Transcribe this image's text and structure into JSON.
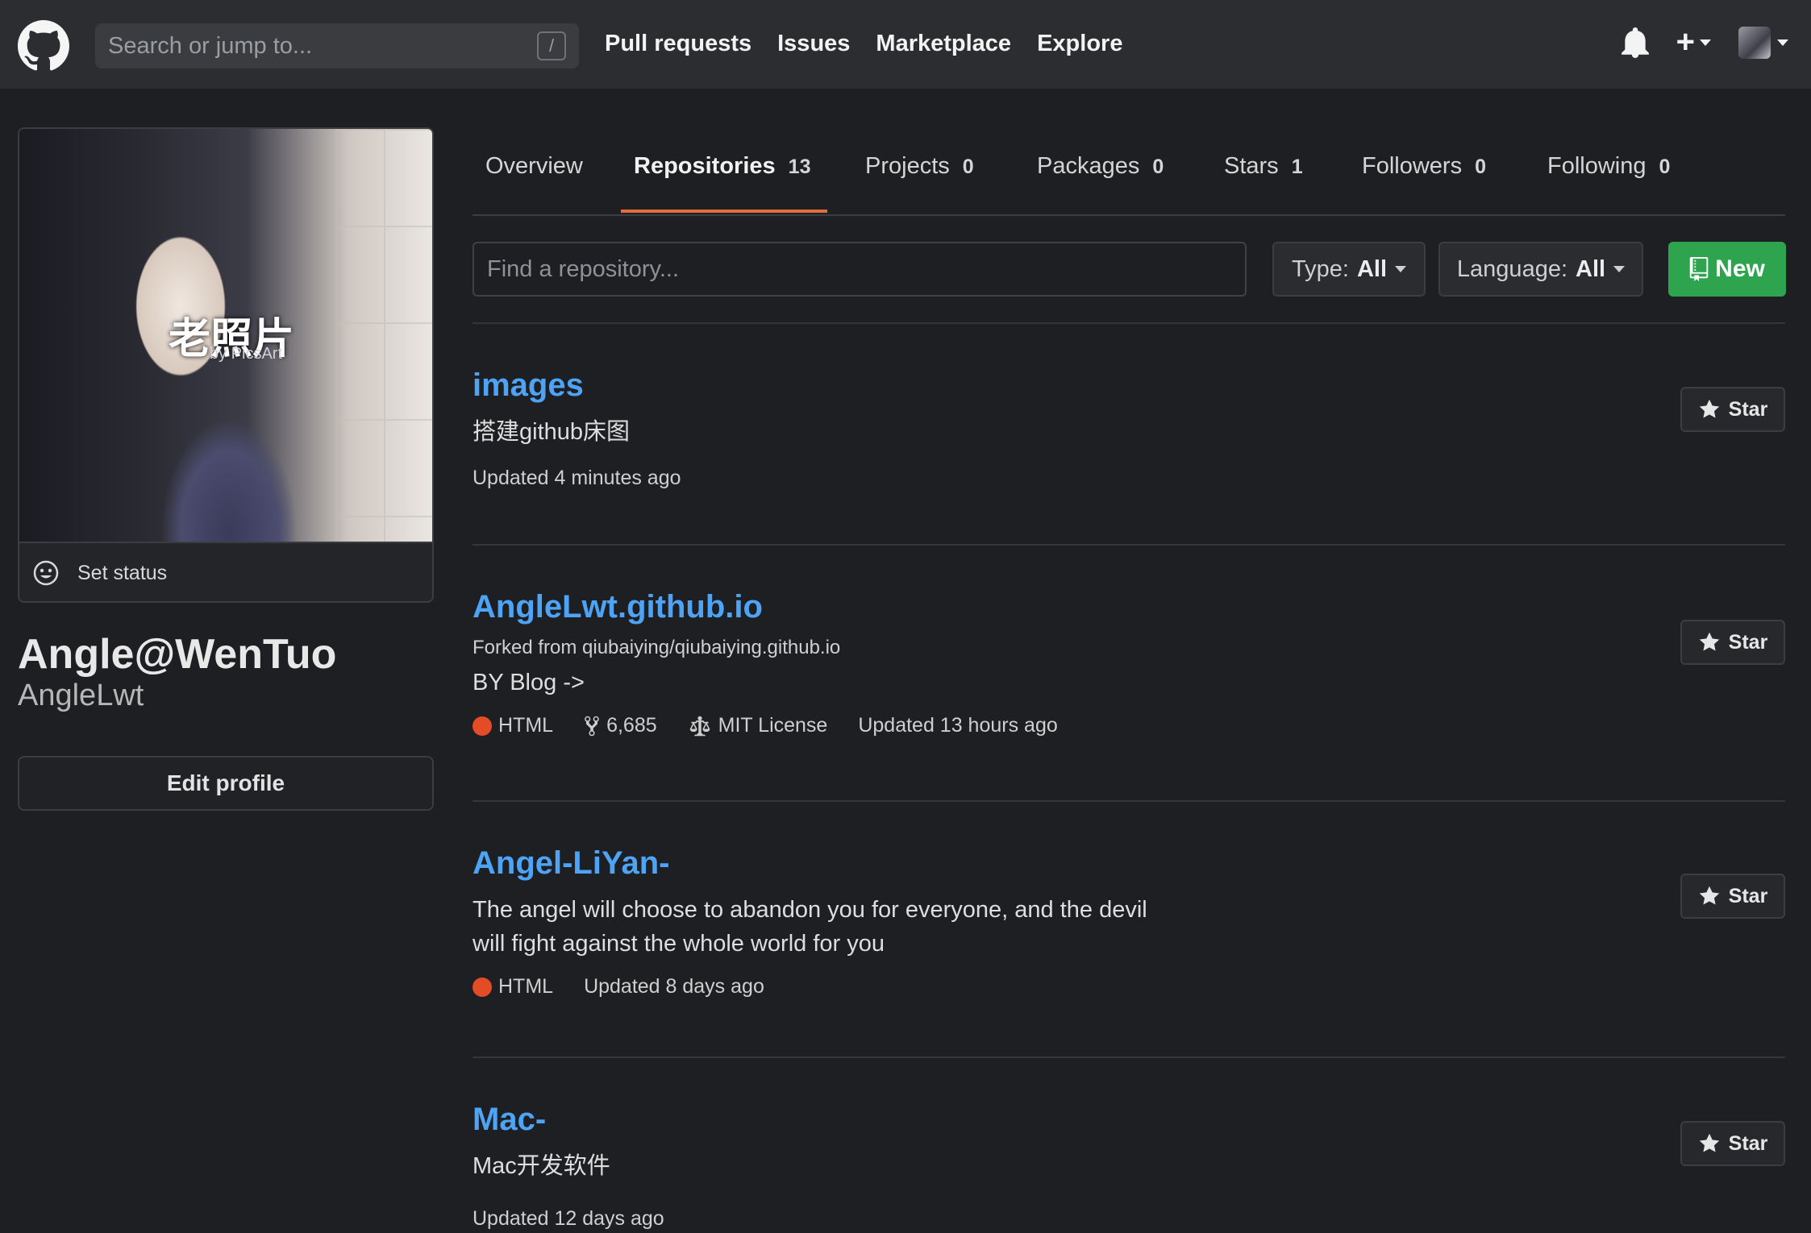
{
  "header": {
    "search_placeholder": "Search or jump to...",
    "slash_key": "/",
    "nav": [
      "Pull requests",
      "Issues",
      "Marketplace",
      "Explore"
    ]
  },
  "profile": {
    "photo_caption": "老照片",
    "photo_watermark": "by PicsArt",
    "set_status": "Set status",
    "full_name": "Angle@WenTuo",
    "username": "AngleLwt",
    "edit_profile": "Edit profile"
  },
  "tabs": [
    {
      "label": "Overview",
      "count": ""
    },
    {
      "label": "Repositories",
      "count": "13"
    },
    {
      "label": "Projects",
      "count": "0"
    },
    {
      "label": "Packages",
      "count": "0"
    },
    {
      "label": "Stars",
      "count": "1"
    },
    {
      "label": "Followers",
      "count": "0"
    },
    {
      "label": "Following",
      "count": "0"
    }
  ],
  "active_tab": "Repositories",
  "filters": {
    "find_placeholder": "Find a repository...",
    "type_label": "Type:",
    "type_value": "All",
    "language_label": "Language:",
    "language_value": "All",
    "new_label": "New"
  },
  "colors": {
    "accent_link": "#4ea3f5",
    "tab_underline": "#e36d3b",
    "new_button": "#2ea44f",
    "html_lang": "#e34c26"
  },
  "repos": [
    {
      "name": "images",
      "forked_from": "",
      "description": "搭建github床图",
      "language": "",
      "forks": "",
      "license": "",
      "updated": "Updated 4 minutes ago",
      "star_label": "Star"
    },
    {
      "name": "AngleLwt.github.io",
      "forked_from": "Forked from qiubaiying/qiubaiying.github.io",
      "description": "BY Blog ->",
      "language": "HTML",
      "forks": "6,685",
      "license": "MIT License",
      "updated": "Updated 13 hours ago",
      "star_label": "Star"
    },
    {
      "name": "Angel-LiYan-",
      "forked_from": "",
      "description": "The angel will choose to abandon you for everyone, and the devil will fight against the whole world for you",
      "language": "HTML",
      "forks": "",
      "license": "",
      "updated": "Updated 8 days ago",
      "star_label": "Star"
    },
    {
      "name": "Mac-",
      "forked_from": "",
      "description": "Mac开发软件",
      "language": "",
      "forks": "",
      "license": "",
      "updated": "Updated 12 days ago",
      "star_label": "Star"
    }
  ]
}
